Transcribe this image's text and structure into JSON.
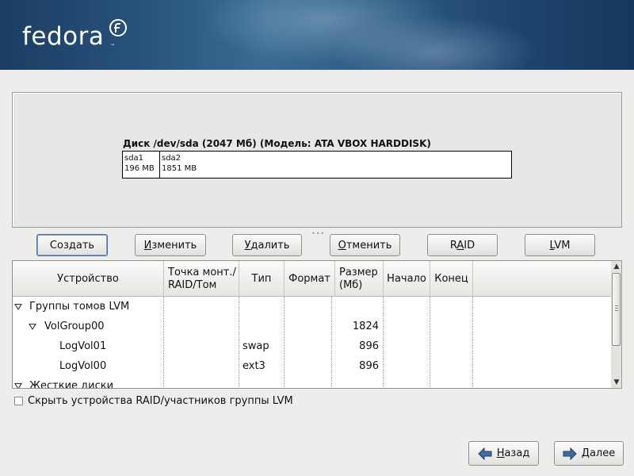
{
  "header": {
    "logo_text": "fedora"
  },
  "disk_map": {
    "title": "Диск /dev/sda (2047 Мб) (Модель: ATA VBOX HARDDISK)",
    "partitions": [
      {
        "name": "sda1",
        "size": "196 MB"
      },
      {
        "name": "sda2",
        "size": "1851 MB"
      }
    ]
  },
  "toolbar": {
    "create": "Создать",
    "edit_pre": "",
    "edit_mn": "И",
    "edit_post": "зменить",
    "delete_pre": "",
    "delete_mn": "У",
    "delete_post": "далить",
    "reset_pre": "",
    "reset_mn": "О",
    "reset_post": "тменить",
    "raid_pre": "R",
    "raid_mn": "A",
    "raid_post": "ID",
    "lvm_pre": "",
    "lvm_mn": "L",
    "lvm_post": "VM"
  },
  "table": {
    "columns": {
      "device": "Устройство",
      "mount_line1": "Точка монт./",
      "mount_line2": "RAID/Том",
      "type": "Тип",
      "format": "Формат",
      "size_line1": "Размер",
      "size_line2": "(Мб)",
      "start": "Начало",
      "end": "Конец"
    },
    "rows": [
      {
        "device": "Группы томов LVM",
        "type": "",
        "size": ""
      },
      {
        "device": "VolGroup00",
        "type": "",
        "size": "1824"
      },
      {
        "device": "LogVol01",
        "type": "swap",
        "size": "896"
      },
      {
        "device": "LogVol00",
        "type": "ext3",
        "size": "896"
      },
      {
        "device": "Жесткие диски",
        "type": "",
        "size": ""
      }
    ]
  },
  "options": {
    "hide_raid_label": "Скрыть устройства RAID/участников группы LVM",
    "hide_raid_checked": false
  },
  "navigation": {
    "back_mn": "Н",
    "back_post": "азад",
    "next_mn": "Д",
    "next_post": "алее"
  }
}
